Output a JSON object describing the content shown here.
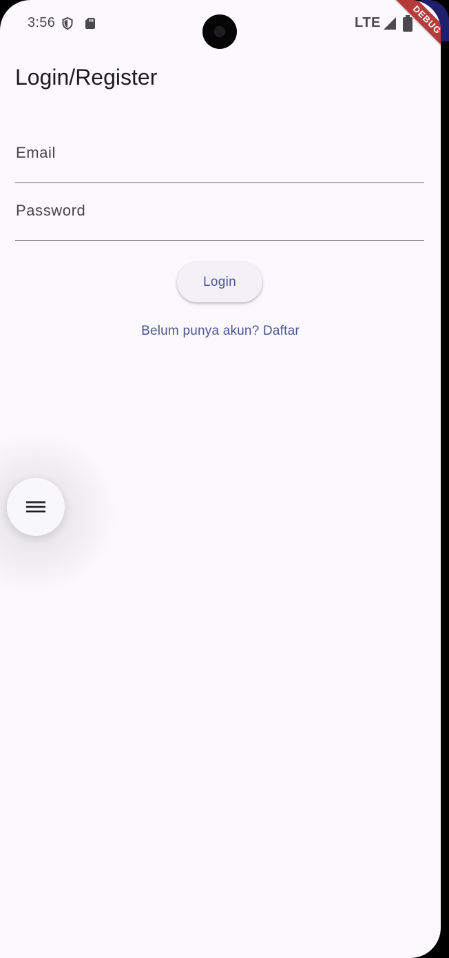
{
  "status_bar": {
    "time": "3:56",
    "network": "LTE",
    "icons": [
      "shield-icon",
      "sd-card-icon",
      "signal-icon",
      "battery-icon"
    ]
  },
  "debug_banner": "DEBUG",
  "app_bar": {
    "title": "Login/Register"
  },
  "form": {
    "email_label": "Email",
    "password_label": "Password",
    "login_button": "Login",
    "register_link": "Belum punya akun? Daftar"
  },
  "fab": {
    "icon": "menu-icon"
  },
  "colors": {
    "background": "#fbf8fe",
    "primary": "#4b5592",
    "text": "#1c1b1f",
    "debug_banner": "#b53a3a"
  }
}
